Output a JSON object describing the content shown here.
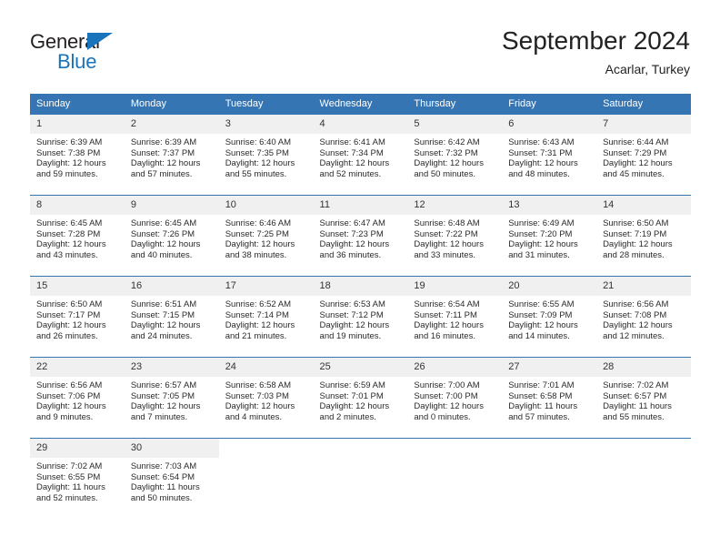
{
  "brand": {
    "name_part1": "General",
    "name_part2": "Blue",
    "triangle_icon": "triangle-logo-icon",
    "accent_color": "#1a74bb"
  },
  "header": {
    "title": "September 2024",
    "subtitle": "Acarlar, Turkey"
  },
  "theme": {
    "header_blue": "#3575b3",
    "daynum_background": "#f0f0f0",
    "text_color": "#2a2a2a"
  },
  "weekdays": [
    "Sunday",
    "Monday",
    "Tuesday",
    "Wednesday",
    "Thursday",
    "Friday",
    "Saturday"
  ],
  "labels": {
    "sunrise_prefix": "Sunrise:",
    "sunset_prefix": "Sunset:",
    "daylight_prefix": "Daylight:"
  },
  "weeks": [
    [
      {
        "day": "1",
        "line1": "Sunrise: 6:39 AM",
        "line2": "Sunset: 7:38 PM",
        "line3": "Daylight: 12 hours",
        "line4": "and 59 minutes."
      },
      {
        "day": "2",
        "line1": "Sunrise: 6:39 AM",
        "line2": "Sunset: 7:37 PM",
        "line3": "Daylight: 12 hours",
        "line4": "and 57 minutes."
      },
      {
        "day": "3",
        "line1": "Sunrise: 6:40 AM",
        "line2": "Sunset: 7:35 PM",
        "line3": "Daylight: 12 hours",
        "line4": "and 55 minutes."
      },
      {
        "day": "4",
        "line1": "Sunrise: 6:41 AM",
        "line2": "Sunset: 7:34 PM",
        "line3": "Daylight: 12 hours",
        "line4": "and 52 minutes."
      },
      {
        "day": "5",
        "line1": "Sunrise: 6:42 AM",
        "line2": "Sunset: 7:32 PM",
        "line3": "Daylight: 12 hours",
        "line4": "and 50 minutes."
      },
      {
        "day": "6",
        "line1": "Sunrise: 6:43 AM",
        "line2": "Sunset: 7:31 PM",
        "line3": "Daylight: 12 hours",
        "line4": "and 48 minutes."
      },
      {
        "day": "7",
        "line1": "Sunrise: 6:44 AM",
        "line2": "Sunset: 7:29 PM",
        "line3": "Daylight: 12 hours",
        "line4": "and 45 minutes."
      }
    ],
    [
      {
        "day": "8",
        "line1": "Sunrise: 6:45 AM",
        "line2": "Sunset: 7:28 PM",
        "line3": "Daylight: 12 hours",
        "line4": "and 43 minutes."
      },
      {
        "day": "9",
        "line1": "Sunrise: 6:45 AM",
        "line2": "Sunset: 7:26 PM",
        "line3": "Daylight: 12 hours",
        "line4": "and 40 minutes."
      },
      {
        "day": "10",
        "line1": "Sunrise: 6:46 AM",
        "line2": "Sunset: 7:25 PM",
        "line3": "Daylight: 12 hours",
        "line4": "and 38 minutes."
      },
      {
        "day": "11",
        "line1": "Sunrise: 6:47 AM",
        "line2": "Sunset: 7:23 PM",
        "line3": "Daylight: 12 hours",
        "line4": "and 36 minutes."
      },
      {
        "day": "12",
        "line1": "Sunrise: 6:48 AM",
        "line2": "Sunset: 7:22 PM",
        "line3": "Daylight: 12 hours",
        "line4": "and 33 minutes."
      },
      {
        "day": "13",
        "line1": "Sunrise: 6:49 AM",
        "line2": "Sunset: 7:20 PM",
        "line3": "Daylight: 12 hours",
        "line4": "and 31 minutes."
      },
      {
        "day": "14",
        "line1": "Sunrise: 6:50 AM",
        "line2": "Sunset: 7:19 PM",
        "line3": "Daylight: 12 hours",
        "line4": "and 28 minutes."
      }
    ],
    [
      {
        "day": "15",
        "line1": "Sunrise: 6:50 AM",
        "line2": "Sunset: 7:17 PM",
        "line3": "Daylight: 12 hours",
        "line4": "and 26 minutes."
      },
      {
        "day": "16",
        "line1": "Sunrise: 6:51 AM",
        "line2": "Sunset: 7:15 PM",
        "line3": "Daylight: 12 hours",
        "line4": "and 24 minutes."
      },
      {
        "day": "17",
        "line1": "Sunrise: 6:52 AM",
        "line2": "Sunset: 7:14 PM",
        "line3": "Daylight: 12 hours",
        "line4": "and 21 minutes."
      },
      {
        "day": "18",
        "line1": "Sunrise: 6:53 AM",
        "line2": "Sunset: 7:12 PM",
        "line3": "Daylight: 12 hours",
        "line4": "and 19 minutes."
      },
      {
        "day": "19",
        "line1": "Sunrise: 6:54 AM",
        "line2": "Sunset: 7:11 PM",
        "line3": "Daylight: 12 hours",
        "line4": "and 16 minutes."
      },
      {
        "day": "20",
        "line1": "Sunrise: 6:55 AM",
        "line2": "Sunset: 7:09 PM",
        "line3": "Daylight: 12 hours",
        "line4": "and 14 minutes."
      },
      {
        "day": "21",
        "line1": "Sunrise: 6:56 AM",
        "line2": "Sunset: 7:08 PM",
        "line3": "Daylight: 12 hours",
        "line4": "and 12 minutes."
      }
    ],
    [
      {
        "day": "22",
        "line1": "Sunrise: 6:56 AM",
        "line2": "Sunset: 7:06 PM",
        "line3": "Daylight: 12 hours",
        "line4": "and 9 minutes."
      },
      {
        "day": "23",
        "line1": "Sunrise: 6:57 AM",
        "line2": "Sunset: 7:05 PM",
        "line3": "Daylight: 12 hours",
        "line4": "and 7 minutes."
      },
      {
        "day": "24",
        "line1": "Sunrise: 6:58 AM",
        "line2": "Sunset: 7:03 PM",
        "line3": "Daylight: 12 hours",
        "line4": "and 4 minutes."
      },
      {
        "day": "25",
        "line1": "Sunrise: 6:59 AM",
        "line2": "Sunset: 7:01 PM",
        "line3": "Daylight: 12 hours",
        "line4": "and 2 minutes."
      },
      {
        "day": "26",
        "line1": "Sunrise: 7:00 AM",
        "line2": "Sunset: 7:00 PM",
        "line3": "Daylight: 12 hours",
        "line4": "and 0 minutes."
      },
      {
        "day": "27",
        "line1": "Sunrise: 7:01 AM",
        "line2": "Sunset: 6:58 PM",
        "line3": "Daylight: 11 hours",
        "line4": "and 57 minutes."
      },
      {
        "day": "28",
        "line1": "Sunrise: 7:02 AM",
        "line2": "Sunset: 6:57 PM",
        "line3": "Daylight: 11 hours",
        "line4": "and 55 minutes."
      }
    ],
    [
      {
        "day": "29",
        "line1": "Sunrise: 7:02 AM",
        "line2": "Sunset: 6:55 PM",
        "line3": "Daylight: 11 hours",
        "line4": "and 52 minutes."
      },
      {
        "day": "30",
        "line1": "Sunrise: 7:03 AM",
        "line2": "Sunset: 6:54 PM",
        "line3": "Daylight: 11 hours",
        "line4": "and 50 minutes."
      },
      {
        "day": "",
        "line1": "",
        "line2": "",
        "line3": "",
        "line4": ""
      },
      {
        "day": "",
        "line1": "",
        "line2": "",
        "line3": "",
        "line4": ""
      },
      {
        "day": "",
        "line1": "",
        "line2": "",
        "line3": "",
        "line4": ""
      },
      {
        "day": "",
        "line1": "",
        "line2": "",
        "line3": "",
        "line4": ""
      },
      {
        "day": "",
        "line1": "",
        "line2": "",
        "line3": "",
        "line4": ""
      }
    ]
  ]
}
